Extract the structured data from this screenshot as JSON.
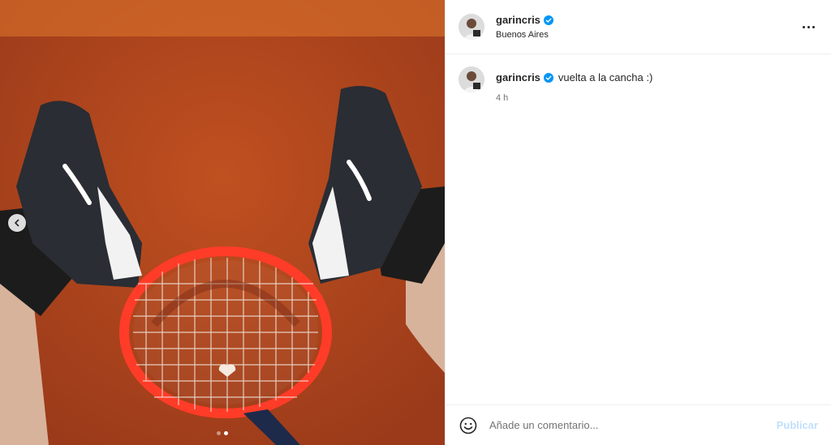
{
  "post": {
    "username": "garincris",
    "location": "Buenos Aires",
    "caption": "vuelta a la cancha :)",
    "time_ago": "4 h",
    "image_alt": "Tenis Nike negras sobre cancha de polvo de ladrillo con raqueta roja",
    "carousel": {
      "count": 2,
      "current": 2
    }
  },
  "comment_box": {
    "placeholder": "Añade un comentario...",
    "publish_label": "Publicar"
  },
  "icons": {
    "verified": "verified-badge-icon",
    "more": "more-options-icon",
    "emoji": "emoji-icon",
    "prev": "chevron-left-icon"
  },
  "colors": {
    "verified": "#0095f6",
    "publish_disabled": "#c0dffd",
    "clay": "#b6461e"
  }
}
